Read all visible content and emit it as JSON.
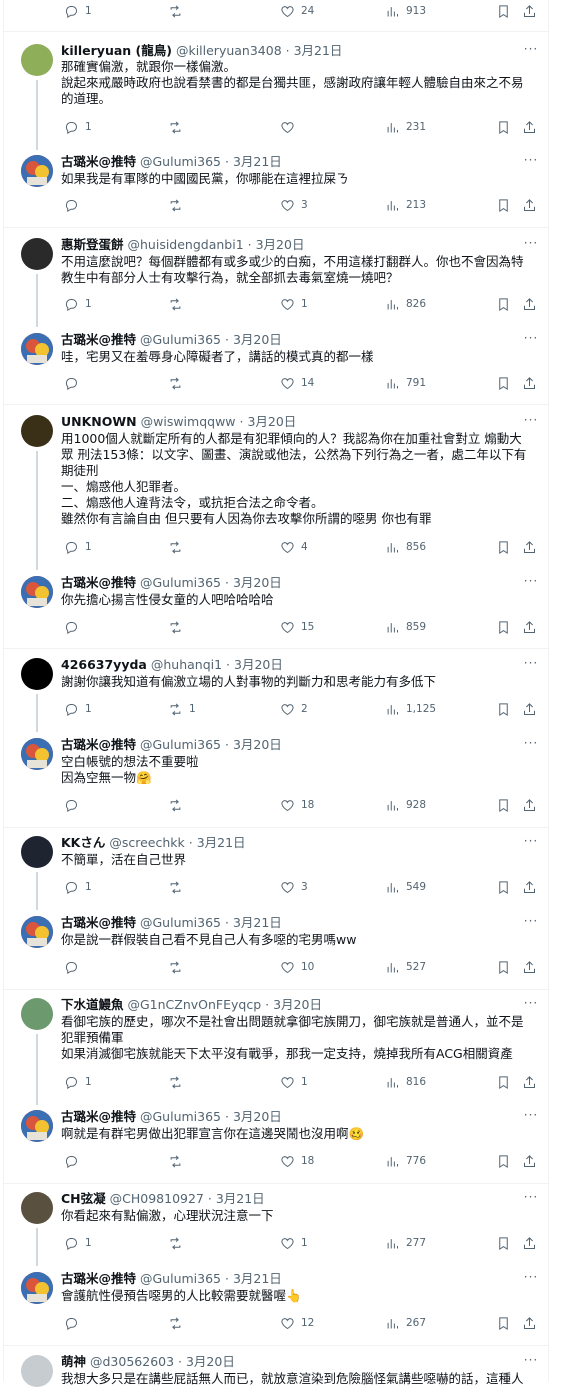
{
  "tweets": [
    {
      "name": "",
      "handle": "",
      "time": "",
      "text": "",
      "reply": "1",
      "retweet": "",
      "like": "24",
      "views": "913"
    },
    {
      "name": "killeryuan (龍鳥)",
      "handle": "@killeryuan3408",
      "time": "3月21日",
      "text": "那確實偏激，就跟你一樣偏激。\n說起來戒嚴時政府也說看禁書的都是台獨共匪，感謝政府讓年輕人體驗自由來之不易的道理。",
      "reply": "1",
      "retweet": "",
      "like": "",
      "views": "231"
    },
    {
      "name": "古璐米@推特",
      "handle": "@Gulumi365",
      "time": "3月21日",
      "text": "如果我是有軍隊的中國國民黨，你哪能在這裡拉屎ㄋ",
      "reply": "",
      "retweet": "",
      "like": "3",
      "views": "213"
    },
    {
      "name": "惠斯登蛋餅",
      "handle": "@huisidengdanbi1",
      "time": "3月20日",
      "text": "不用這麼說吧？每個群體都有或多或少的白痴，不用這樣打翻群人。你也不會因為特教生中有部分人士有攻擊行為，就全部抓去毒氣室燒一燒吧？",
      "reply": "1",
      "retweet": "",
      "like": "1",
      "views": "826"
    },
    {
      "name": "古璐米@推特",
      "handle": "@Gulumi365",
      "time": "3月20日",
      "text": "哇，宅男又在羞辱身心障礙者了，講話的模式真的都一樣",
      "reply": "",
      "retweet": "",
      "like": "14",
      "views": "791"
    },
    {
      "name": "UNKNOWN",
      "handle": "@wiswimqqww",
      "time": "3月20日",
      "text": "用1000個人就斷定所有的人都是有犯罪傾向的人？我認為你在加重社會對立 煽動大眾 刑法153條：以文字、圖畫、演說或他法，公然為下列行為之一者，處二年以下有期徒刑\n一、煽惑他人犯罪者。\n二、煽惑他人違背法令，或抗拒合法之命令者。\n雖然你有言論自由 但只要有人因為你去攻擊你所謂的噁男 你也有罪",
      "reply": "1",
      "retweet": "",
      "like": "4",
      "views": "856"
    },
    {
      "name": "古璐米@推特",
      "handle": "@Gulumi365",
      "time": "3月20日",
      "text": "你先擔心揚言性侵女童的人吧哈哈哈哈",
      "reply": "",
      "retweet": "",
      "like": "15",
      "views": "859"
    },
    {
      "name": "426637yyda",
      "handle": "@huhanqi1",
      "time": "3月20日",
      "text": "謝謝你讓我知道有偏激立場的人對事物的判斷力和思考能力有多低下",
      "reply": "1",
      "retweet": "1",
      "like": "2",
      "views": "1,125"
    },
    {
      "name": "古璐米@推特",
      "handle": "@Gulumi365",
      "time": "3月20日",
      "text": "空白帳號的想法不重要啦\n因為空無一物🤗",
      "reply": "",
      "retweet": "",
      "like": "18",
      "views": "928"
    },
    {
      "name": "KKさん",
      "handle": "@screechkk",
      "time": "3月21日",
      "text": "不簡單，活在自己世界",
      "reply": "1",
      "retweet": "",
      "like": "3",
      "views": "549"
    },
    {
      "name": "古璐米@推特",
      "handle": "@Gulumi365",
      "time": "3月21日",
      "text": "你是說一群假裝自己看不見自己人有多噁的宅男嗎ww",
      "reply": "",
      "retweet": "",
      "like": "10",
      "views": "527"
    },
    {
      "name": "下水道鰻魚",
      "handle": "@G1nCZnvOnFEyqcp",
      "time": "3月20日",
      "text": "看御宅族的歷史，哪次不是社會出問題就拿御宅族開刀，御宅族就是普通人，並不是犯罪預備軍\n如果消滅御宅族就能天下太平沒有戰爭，那我一定支持，燒掉我所有ACG相關資產",
      "reply": "1",
      "retweet": "",
      "like": "1",
      "views": "816"
    },
    {
      "name": "古璐米@推特",
      "handle": "@Gulumi365",
      "time": "3月20日",
      "text": "啊就是有群宅男做出犯罪宣言你在這邊哭鬧也沒用啊🥴",
      "reply": "",
      "retweet": "",
      "like": "18",
      "views": "776"
    },
    {
      "name": "CH弦凝",
      "handle": "@CH09810927",
      "time": "3月21日",
      "text": "你看起來有點偏激，心理狀況注意一下",
      "reply": "1",
      "retweet": "",
      "like": "1",
      "views": "277"
    },
    {
      "name": "古璐米@推特",
      "handle": "@Gulumi365",
      "time": "3月21日",
      "text": "會護航性侵預告噁男的人比較需要就醫喔👆",
      "reply": "",
      "retweet": "",
      "like": "12",
      "views": "267"
    },
    {
      "name": "萌神",
      "handle": "@d30562603",
      "time": "3月20日",
      "text": "我想大多只是在講些屁話無人而已，就放意渲染到危險腦怪氣講些噁嚇的話，這種人",
      "reply": "",
      "retweet": "",
      "like": "",
      "views": ""
    }
  ],
  "icons": {
    "reply": "reply-icon",
    "retweet": "retweet-icon",
    "like": "heart-icon",
    "views": "views-icon",
    "bookmark": "bookmark-icon",
    "share": "share-icon",
    "more": "more-icon"
  },
  "colors": {
    "text": "#0f1419",
    "secondary": "#536471",
    "line": "#cfd9de",
    "divider": "#eff3f4"
  }
}
